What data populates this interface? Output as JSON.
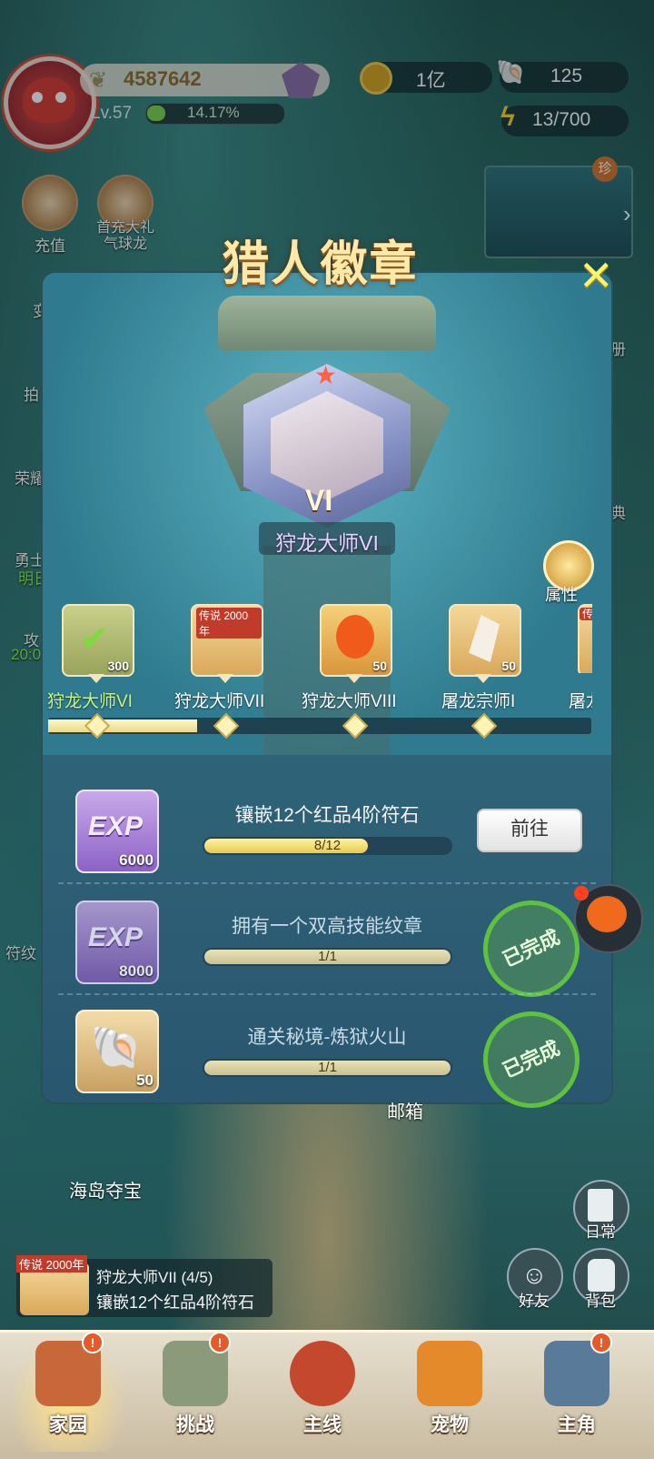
{
  "hud": {
    "power": "4587642",
    "level": "Lv.57",
    "exp_percent": "14.17%",
    "exp_fraction": 0.1417,
    "gold": "1亿",
    "shells": "125",
    "energy": "13/700",
    "minimap_tag": "珍"
  },
  "side_left": [
    {
      "label": "充值"
    },
    {
      "label": "首充大礼"
    },
    {
      "label": "气球龙"
    }
  ],
  "side_partial": [
    "变",
    "拍",
    "荣耀",
    "勇士",
    "明日",
    "攻",
    "20:0",
    "符纹"
  ],
  "side_right_partial": [
    "册",
    "典"
  ],
  "panel": {
    "title": "猎人徽章",
    "badge_numeral": "VI",
    "badge_name": "狩龙大师VI",
    "attr_label": "属性"
  },
  "milestones": [
    {
      "label": "狩龙大师VI",
      "count": "300",
      "claimed": true,
      "tag": ""
    },
    {
      "label": "狩龙大师VII",
      "count": "",
      "claimed": false,
      "tag": "传说 2000年"
    },
    {
      "label": "狩龙大师VIII",
      "count": "50",
      "claimed": false,
      "tag": ""
    },
    {
      "label": "屠龙宗师I",
      "count": "50",
      "claimed": false,
      "tag": ""
    },
    {
      "label": "屠龙",
      "count": "",
      "claimed": false,
      "tag": "传说"
    }
  ],
  "milestone_progress": 0.28,
  "tasks": [
    {
      "title": "镶嵌12个红品4阶符石",
      "progress": "8/12",
      "fraction": 0.667,
      "reward_label": "EXP",
      "reward_count": "6000",
      "action": "前往",
      "done": false
    },
    {
      "title": "拥有一个双高技能纹章",
      "progress": "1/1",
      "fraction": 1,
      "reward_label": "EXP",
      "reward_count": "8000",
      "action": "已完成",
      "done": true
    },
    {
      "title": "通关秘境-炼狱火山",
      "progress": "1/1",
      "fraction": 1,
      "reward_label": "",
      "reward_count": "50",
      "action": "已完成",
      "done": true
    }
  ],
  "map_labels": {
    "island": "海岛夺宝",
    "chest": "邮箱"
  },
  "quest": {
    "tag": "传说 2000年",
    "title": "狩龙大师VII (4/5)",
    "desc": "镶嵌12个红品4阶符石"
  },
  "right_buttons": [
    {
      "label": "日常"
    },
    {
      "label": "好友"
    },
    {
      "label": "背包"
    }
  ],
  "navbar": [
    {
      "label": "家园",
      "active": true,
      "alert": true,
      "color": "#c8683a"
    },
    {
      "label": "挑战",
      "active": false,
      "alert": true,
      "color": "#8a9a7a"
    },
    {
      "label": "主线",
      "active": false,
      "alert": false,
      "color": "#c4482e"
    },
    {
      "label": "宠物",
      "active": false,
      "alert": false,
      "color": "#e48a2a"
    },
    {
      "label": "主角",
      "active": false,
      "alert": true,
      "color": "#5a7a9a"
    }
  ]
}
